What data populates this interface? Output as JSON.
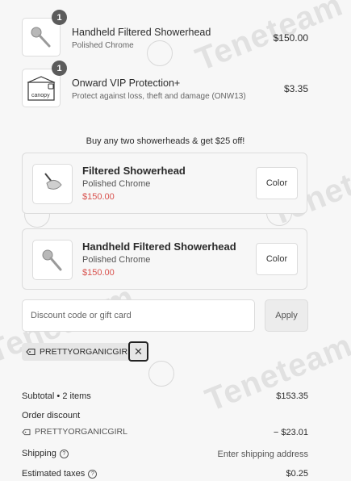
{
  "cart": {
    "items": [
      {
        "title": "Handheld Filtered Showerhead",
        "variant": "Polished Chrome",
        "price": "$150.00",
        "qty": "1"
      },
      {
        "title": "Onward VIP Protection+",
        "variant": "Protect against loss, theft and damage (ONW13)",
        "price": "$3.35",
        "qty": "1",
        "thumb_text": "canopy"
      }
    ]
  },
  "promo": {
    "text": "Buy any two showerheads & get $25 off!"
  },
  "upsells": [
    {
      "title": "Filtered Showerhead",
      "variant": "Polished Chrome",
      "price": "$150.00",
      "button": "Color"
    },
    {
      "title": "Handheld Filtered Showerhead",
      "variant": "Polished Chrome",
      "price": "$150.00",
      "button": "Color"
    }
  ],
  "discount": {
    "placeholder": "Discount code or gift card",
    "apply_label": "Apply",
    "applied_code": "PRETTYORGANICGIRL",
    "remove_symbol": "✕"
  },
  "summary": {
    "subtotal_label": "Subtotal • 2 items",
    "subtotal_value": "$153.35",
    "order_discount_label": "Order discount",
    "discount_code": "PRETTYORGANICGIRL",
    "discount_value": "− $23.01",
    "shipping_label": "Shipping",
    "shipping_value": "Enter shipping address",
    "taxes_label": "Estimated taxes",
    "taxes_value": "$0.25"
  },
  "watermark": {
    "text": "Teneteam"
  },
  "colors": {
    "accent_price": "#d9534f",
    "badge": "#5c5c5c"
  }
}
